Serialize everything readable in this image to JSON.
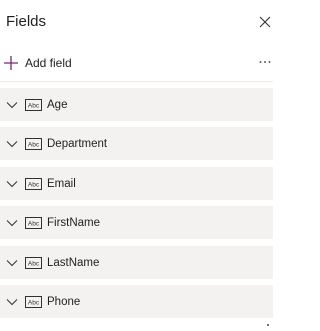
{
  "panel": {
    "title": "Fields",
    "close_icon": "close-icon",
    "more_icon": "more-horizontal-icon"
  },
  "toolbar": {
    "add_field_label": "Add field",
    "add_icon": "plus-icon",
    "accent_color": "#742774"
  },
  "fields": [
    {
      "label": "Age",
      "type_icon": "text-abc-icon"
    },
    {
      "label": "Department",
      "type_icon": "text-abc-icon"
    },
    {
      "label": "Email",
      "type_icon": "text-abc-icon"
    },
    {
      "label": "FirstName",
      "type_icon": "text-abc-icon"
    },
    {
      "label": "LastName",
      "type_icon": "text-abc-icon"
    },
    {
      "label": "Phone",
      "type_icon": "text-abc-icon"
    }
  ],
  "colors": {
    "row_background": "#f3f2f1",
    "text": "#201f1e"
  }
}
